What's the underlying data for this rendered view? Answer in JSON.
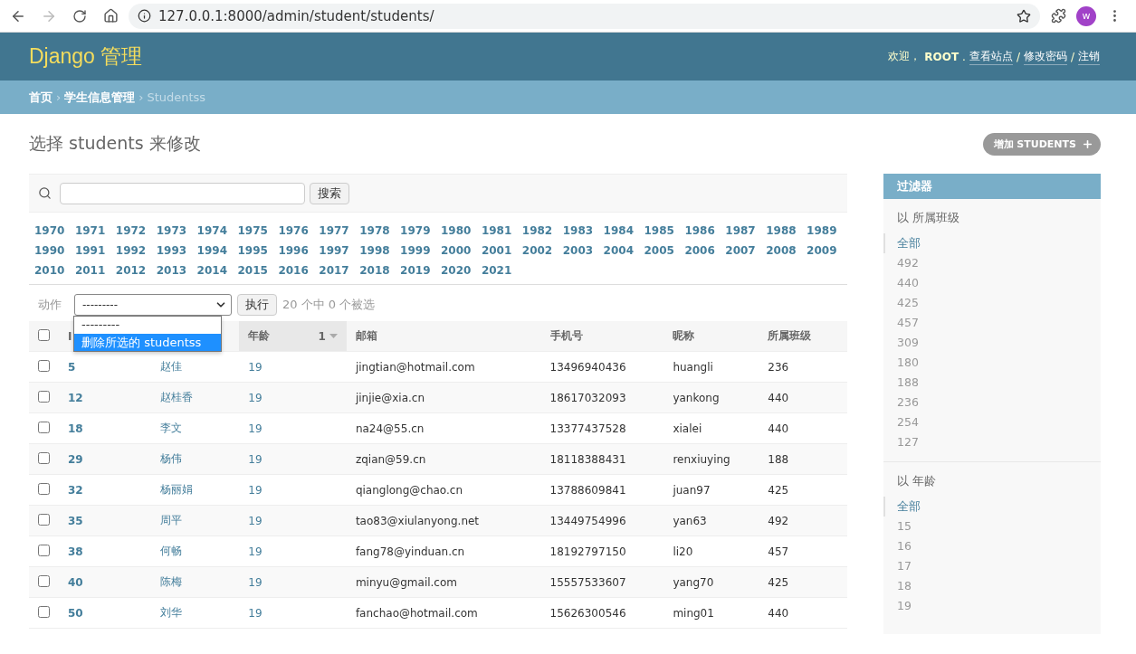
{
  "browser": {
    "url": "127.0.0.1:8000/admin/student/students/",
    "forward_disabled": true,
    "avatar": "w"
  },
  "header": {
    "brand": "Django 管理",
    "welcome": "欢迎，",
    "user": "ROOT",
    "user_suffix": ".",
    "separator": "/",
    "links": [
      "查看站点",
      "修改密码",
      "注销"
    ]
  },
  "breadcrumbs": {
    "separator": "›",
    "items": [
      {
        "label": "首页",
        "link": true
      },
      {
        "label": "学生信息管理",
        "link": true
      },
      {
        "label": "Studentss",
        "link": false
      }
    ]
  },
  "title": "选择 students 来修改",
  "add_button": "增加 STUDENTS",
  "search": {
    "button": "搜索"
  },
  "years": [
    "1970",
    "1971",
    "1972",
    "1973",
    "1974",
    "1975",
    "1976",
    "1977",
    "1978",
    "1979",
    "1980",
    "1981",
    "1982",
    "1983",
    "1984",
    "1985",
    "1986",
    "1987",
    "1988",
    "1989",
    "1990",
    "1991",
    "1992",
    "1993",
    "1994",
    "1995",
    "1996",
    "1997",
    "1998",
    "1999",
    "2000",
    "2001",
    "2002",
    "2003",
    "2004",
    "2005",
    "2006",
    "2007",
    "2008",
    "2009",
    "2010",
    "2011",
    "2012",
    "2013",
    "2014",
    "2015",
    "2016",
    "2017",
    "2018",
    "2019",
    "2020",
    "2021"
  ],
  "actions": {
    "label": "动作",
    "value": "---------",
    "go": "执行",
    "counter": "20 个中 0 个被选",
    "expanded": true,
    "options": [
      {
        "label": "---------",
        "highlighted": false
      },
      {
        "label": "删除所选的 studentss",
        "highlighted": true
      }
    ]
  },
  "table": {
    "select_all_checked": false,
    "columns": [
      {
        "label": "I",
        "sorted": false
      },
      {
        "sorted": false
      },
      {
        "label": "年龄",
        "sorted": true,
        "sort_priority": "1"
      },
      {
        "label": "邮箱",
        "sorted": false
      },
      {
        "label": "手机号",
        "sorted": false
      },
      {
        "label": "昵称",
        "sorted": false
      },
      {
        "label": "所属班级",
        "sorted": false
      }
    ],
    "rows": [
      {
        "checked": false,
        "cells": [
          "5",
          "赵佳",
          "19",
          "jingtian@hotmail.com",
          "13496940436",
          "huangli",
          "236"
        ]
      },
      {
        "checked": false,
        "cells": [
          "12",
          "赵桂香",
          "19",
          "jinjie@xia.cn",
          "18617032093",
          "yankong",
          "440"
        ]
      },
      {
        "checked": false,
        "cells": [
          "18",
          "李文",
          "19",
          "na24@55.cn",
          "13377437528",
          "xialei",
          "440"
        ]
      },
      {
        "checked": false,
        "cells": [
          "29",
          "杨伟",
          "19",
          "zqian@59.cn",
          "18118388431",
          "renxiuying",
          "188"
        ]
      },
      {
        "checked": false,
        "cells": [
          "32",
          "杨丽娟",
          "19",
          "qianglong@chao.cn",
          "13788609841",
          "juan97",
          "425"
        ]
      },
      {
        "checked": false,
        "cells": [
          "35",
          "周平",
          "19",
          "tao83@xiulanyong.net",
          "13449754996",
          "yan63",
          "492"
        ]
      },
      {
        "checked": false,
        "cells": [
          "38",
          "何畅",
          "19",
          "fang78@yinduan.cn",
          "18192797150",
          "li20",
          "457"
        ]
      },
      {
        "checked": false,
        "cells": [
          "40",
          "陈梅",
          "19",
          "minyu@gmail.com",
          "15557533607",
          "yang70",
          "425"
        ]
      },
      {
        "checked": false,
        "cells": [
          "50",
          "刘华",
          "19",
          "fanchao@hotmail.com",
          "15626300546",
          "ming01",
          "440"
        ]
      }
    ]
  },
  "filter": {
    "title": "过滤器",
    "groups": [
      {
        "title": "以 所属班级",
        "items": [
          {
            "label": "全部",
            "selected": true
          },
          {
            "label": "492",
            "selected": false
          },
          {
            "label": "440",
            "selected": false
          },
          {
            "label": "425",
            "selected": false
          },
          {
            "label": "457",
            "selected": false
          },
          {
            "label": "309",
            "selected": false
          },
          {
            "label": "180",
            "selected": false
          },
          {
            "label": "188",
            "selected": false
          },
          {
            "label": "236",
            "selected": false
          },
          {
            "label": "254",
            "selected": false
          },
          {
            "label": "127",
            "selected": false
          }
        ]
      },
      {
        "title": "以 年龄",
        "items": [
          {
            "label": "全部",
            "selected": true
          },
          {
            "label": "15",
            "selected": false
          },
          {
            "label": "16",
            "selected": false
          },
          {
            "label": "17",
            "selected": false
          },
          {
            "label": "18",
            "selected": false
          },
          {
            "label": "19",
            "selected": false
          }
        ]
      }
    ]
  }
}
